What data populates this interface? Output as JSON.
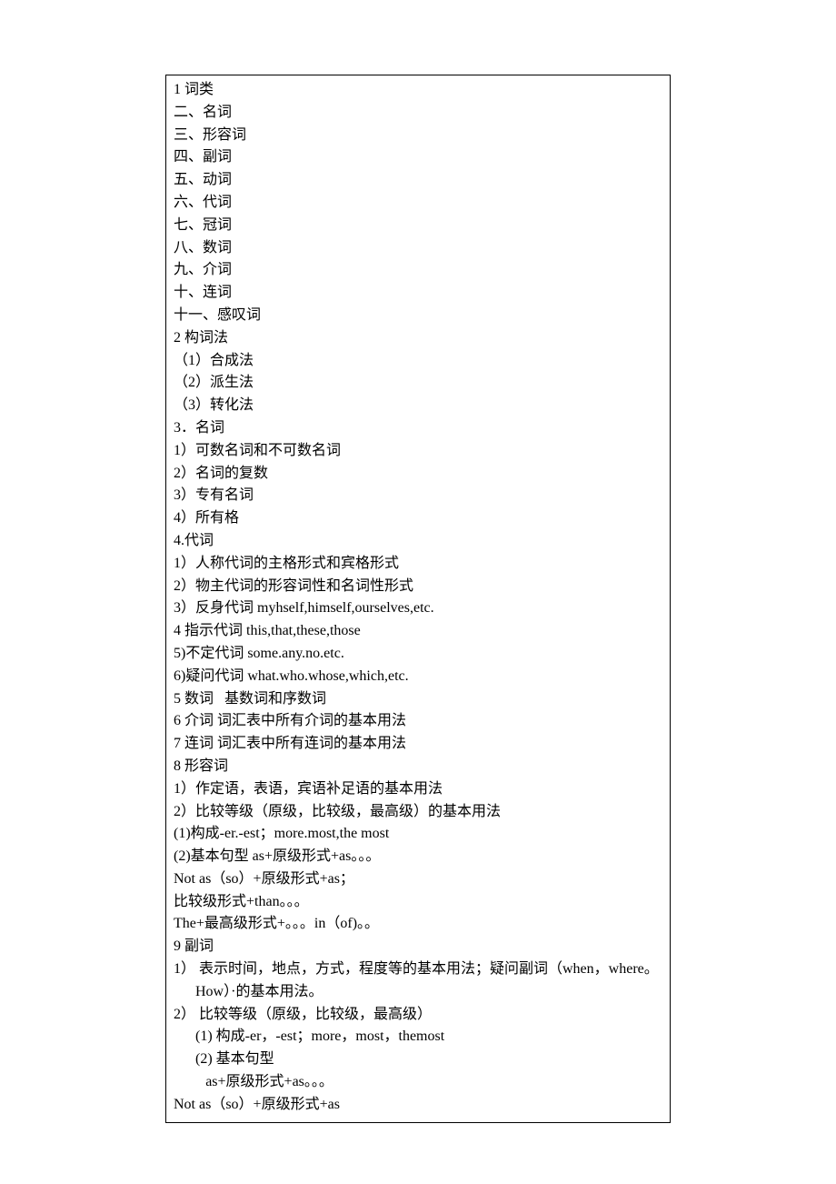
{
  "lines": [
    {
      "cls": "",
      "text": "1 词类"
    },
    {
      "cls": "",
      "text": "二、名词"
    },
    {
      "cls": "",
      "text": "三、形容词"
    },
    {
      "cls": "",
      "text": "四、副词"
    },
    {
      "cls": "",
      "text": "五、动词"
    },
    {
      "cls": "",
      "text": "六、代词"
    },
    {
      "cls": "",
      "text": "七、冠词"
    },
    {
      "cls": "",
      "text": "八、数词"
    },
    {
      "cls": "",
      "text": "九、介词"
    },
    {
      "cls": "",
      "text": "十、连词"
    },
    {
      "cls": "",
      "text": "十一、感叹词"
    },
    {
      "cls": "",
      "text": "2 构词法"
    },
    {
      "cls": "",
      "text": "（1）合成法"
    },
    {
      "cls": "",
      "text": "（2）派生法"
    },
    {
      "cls": "",
      "text": "（3）转化法"
    },
    {
      "cls": "",
      "text": "3．名词"
    },
    {
      "cls": "",
      "text": "1）可数名词和不可数名词"
    },
    {
      "cls": "",
      "text": "2）名词的复数"
    },
    {
      "cls": "",
      "text": "3）专有名词"
    },
    {
      "cls": "",
      "text": "4）所有格"
    },
    {
      "cls": "",
      "text": "4.代词"
    },
    {
      "cls": "",
      "text": "1）人称代词的主格形式和宾格形式"
    },
    {
      "cls": "",
      "text": "2）物主代词的形容词性和名词性形式"
    },
    {
      "cls": "",
      "text": "3）反身代词 myhself,himself,ourselves,etc."
    },
    {
      "cls": "",
      "text": "4 指示代词 this,that,these,those"
    },
    {
      "cls": "",
      "text": "5)不定代词 some.any.no.etc."
    },
    {
      "cls": "",
      "text": "6)疑问代词 what.who.whose,which,etc."
    },
    {
      "cls": "",
      "text": "5 数词   基数词和序数词"
    },
    {
      "cls": "",
      "text": "6 介词 词汇表中所有介词的基本用法"
    },
    {
      "cls": "",
      "text": "7 连词 词汇表中所有连词的基本用法"
    },
    {
      "cls": "",
      "text": "8 形容词"
    },
    {
      "cls": "",
      "text": "1）作定语，表语，宾语补足语的基本用法"
    },
    {
      "cls": "",
      "text": "2）比较等级（原级，比较级，最高级）的基本用法"
    },
    {
      "cls": "",
      "text": "(1)构成-er.-est；more.most,the most"
    },
    {
      "cls": "",
      "text": "(2)基本句型 as+原级形式+as。。。"
    },
    {
      "cls": "",
      "text": "Not as（so）+原级形式+as；"
    },
    {
      "cls": "",
      "text": "比较级形式+than。。。"
    },
    {
      "cls": "",
      "text": "The+最高级形式+。。。in（of)。。"
    },
    {
      "cls": "",
      "text": "9 副词"
    },
    {
      "cls": "",
      "text": "1） 表示时间，地点，方式，程度等的基本用法；疑问副词（when，where。"
    },
    {
      "cls": "indent1",
      "text": "How）·的基本用法。"
    },
    {
      "cls": "",
      "text": "2） 比较等级（原级，比较级，最高级）"
    },
    {
      "cls": "indent1",
      "text": "(1) 构成-er，-est；more，most，themost"
    },
    {
      "cls": "indent1",
      "text": "(2) 基本句型"
    },
    {
      "cls": "indent2",
      "text": "as+原级形式+as。。。"
    },
    {
      "cls": "",
      "text": "Not as（so）+原级形式+as"
    }
  ]
}
